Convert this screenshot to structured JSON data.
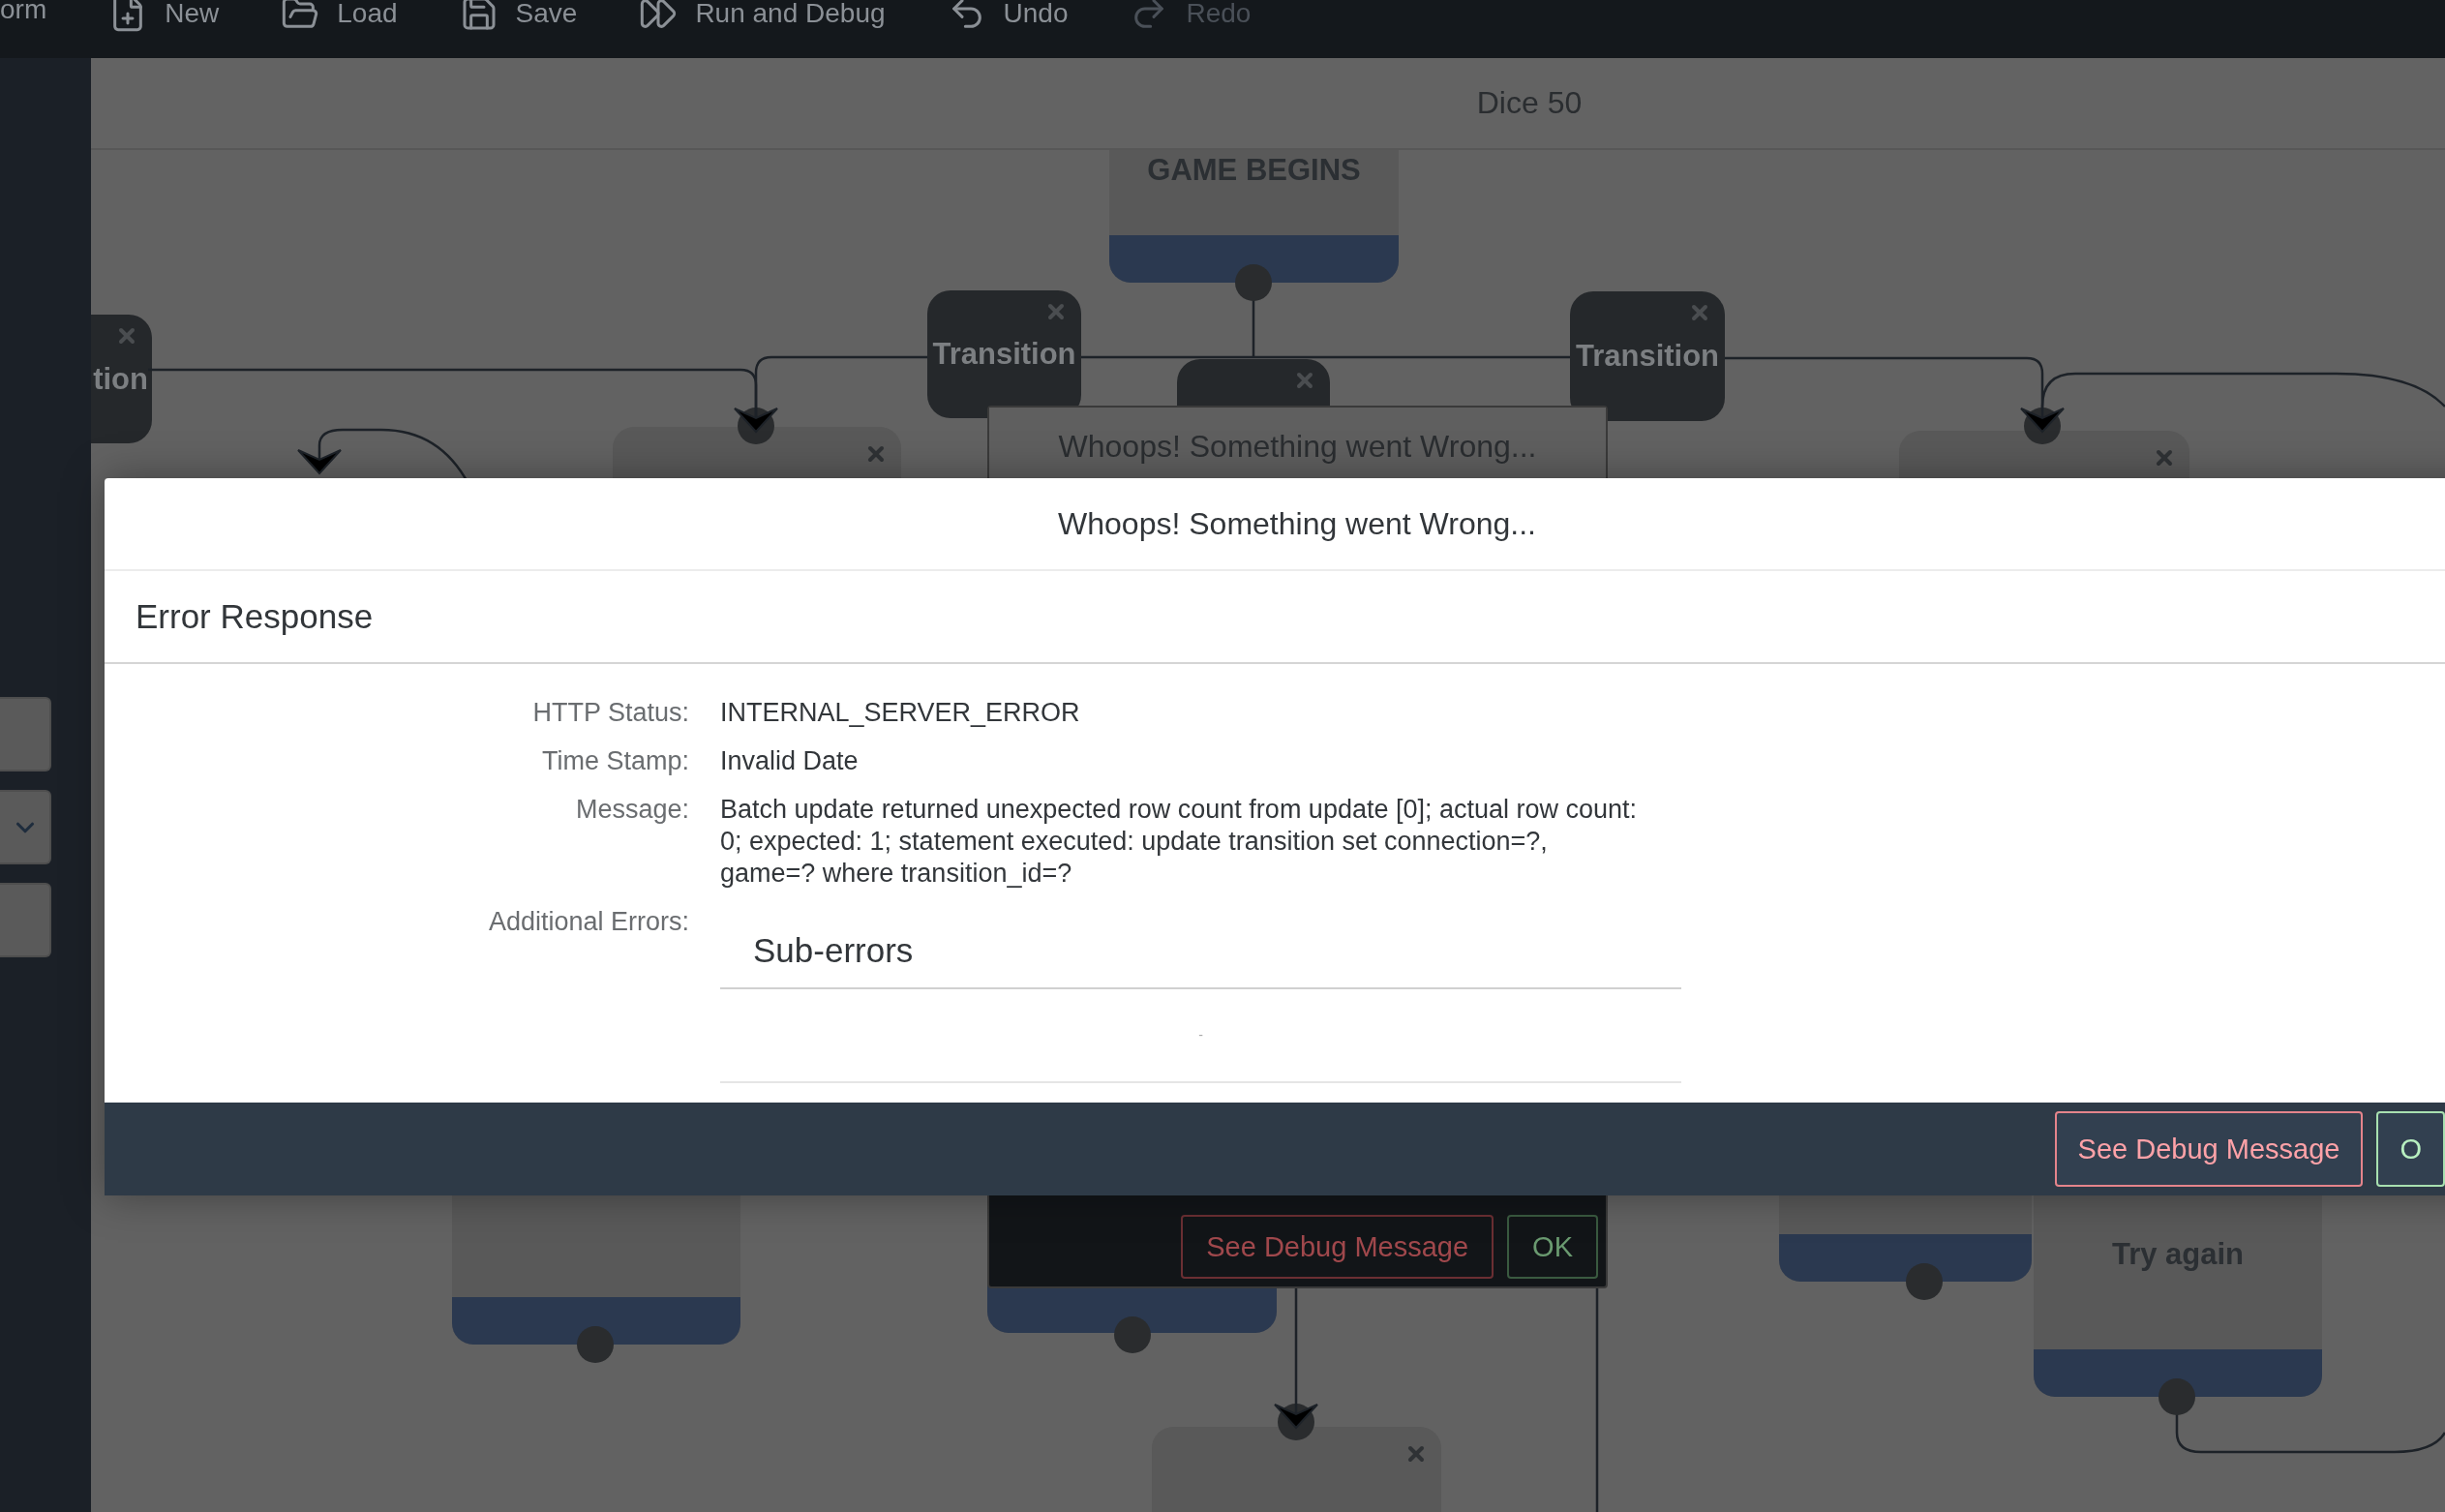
{
  "toolbar": {
    "items": [
      {
        "label": "orm",
        "disabled": false
      },
      {
        "label": "New",
        "disabled": false
      },
      {
        "label": "Load",
        "disabled": false
      },
      {
        "label": "Save",
        "disabled": false
      },
      {
        "label": "Run and Debug",
        "disabled": false
      },
      {
        "label": "Undo",
        "disabled": false
      },
      {
        "label": "Redo",
        "disabled": true
      }
    ]
  },
  "sidebar": {
    "buttons": [
      {
        "kind": "blank"
      },
      {
        "kind": "dropdown"
      },
      {
        "kind": "blank"
      }
    ]
  },
  "canvas": {
    "title": "Dice 50",
    "nodes": [
      {
        "kind": "state",
        "label": "GAME BEGINS"
      },
      {
        "kind": "transition",
        "label": "tion",
        "closable": true
      },
      {
        "kind": "transition",
        "label": "Transition",
        "closable": true
      },
      {
        "kind": "transition",
        "label": "Transition",
        "closable": true
      },
      {
        "kind": "transition",
        "closable": true
      },
      {
        "kind": "state",
        "closable": true
      },
      {
        "kind": "state",
        "closable": true
      },
      {
        "kind": "state"
      },
      {
        "kind": "state"
      },
      {
        "kind": "state"
      },
      {
        "kind": "state",
        "label": "Try again"
      },
      {
        "kind": "state",
        "closable": true
      }
    ]
  },
  "background_dialog": {
    "title": "Whoops! Something went Wrong...",
    "buttons": [
      {
        "label": "See Debug Message",
        "kind": "debug"
      },
      {
        "label": "OK",
        "kind": "ok"
      }
    ]
  },
  "dialog": {
    "title": "Whoops! Something went Wrong...",
    "section_title": "Error Response",
    "fields": [
      {
        "label": "HTTP Status:",
        "value": "INTERNAL_SERVER_ERROR"
      },
      {
        "label": "Time Stamp:",
        "value": "Invalid Date"
      },
      {
        "label": "Message:",
        "value": "Batch update returned unexpected row count from update [0]; actual row count: 0; expected: 1; statement executed: update transition set connection=?, game=? where transition_id=?"
      }
    ],
    "additional_errors": {
      "label": "Additional Errors:",
      "title": "Sub-errors",
      "empty_text": "-"
    },
    "buttons": [
      {
        "label": "See Debug Message",
        "kind": "debug"
      },
      {
        "label": "O",
        "kind": "ok"
      }
    ]
  }
}
